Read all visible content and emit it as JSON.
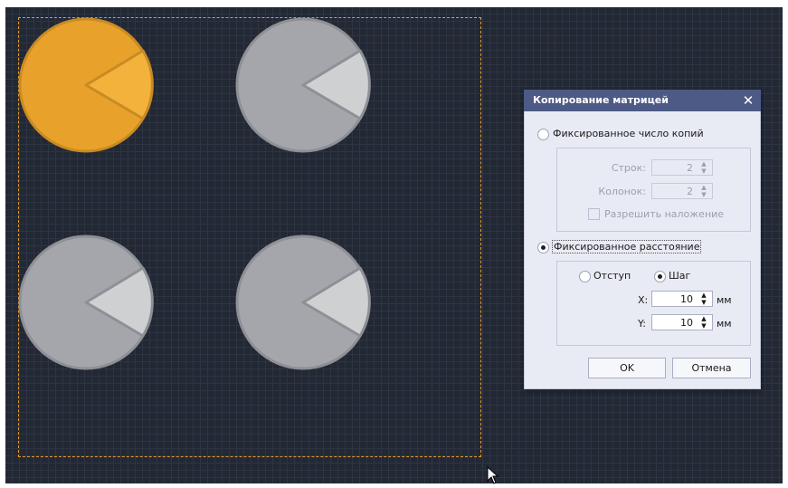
{
  "dialog": {
    "title": "Копирование матрицей",
    "close_icon": "close-icon",
    "fixed_copies": {
      "label": "Фиксированное число копий",
      "selected": false,
      "rows_label": "Строк:",
      "rows_value": "2",
      "cols_label": "Колонок:",
      "cols_value": "2",
      "allow_overlap_label": "Разрешить наложение",
      "allow_overlap_checked": false
    },
    "fixed_distance": {
      "label": "Фиксированное расстояние",
      "selected": true,
      "offset_label": "Отступ",
      "offset_selected": false,
      "step_label": "Шаг",
      "step_selected": true,
      "x_label": "X:",
      "x_value": "10",
      "y_label": "Y:",
      "y_value": "10",
      "unit": "мм"
    },
    "ok_label": "OK",
    "cancel_label": "Отмена"
  },
  "colors": {
    "canvas": "#222834",
    "selected_pie": "#e8a22c",
    "selected_slice": "#f3b23b",
    "pie": "#a5a6ab",
    "pie_slice": "#cfd0d2",
    "selection_border": "#e69a2e",
    "dialog_title": "#4d5a85"
  },
  "icons": [
    "close-icon",
    "spin-up-icon",
    "spin-down-icon",
    "mouse-cursor-icon"
  ]
}
